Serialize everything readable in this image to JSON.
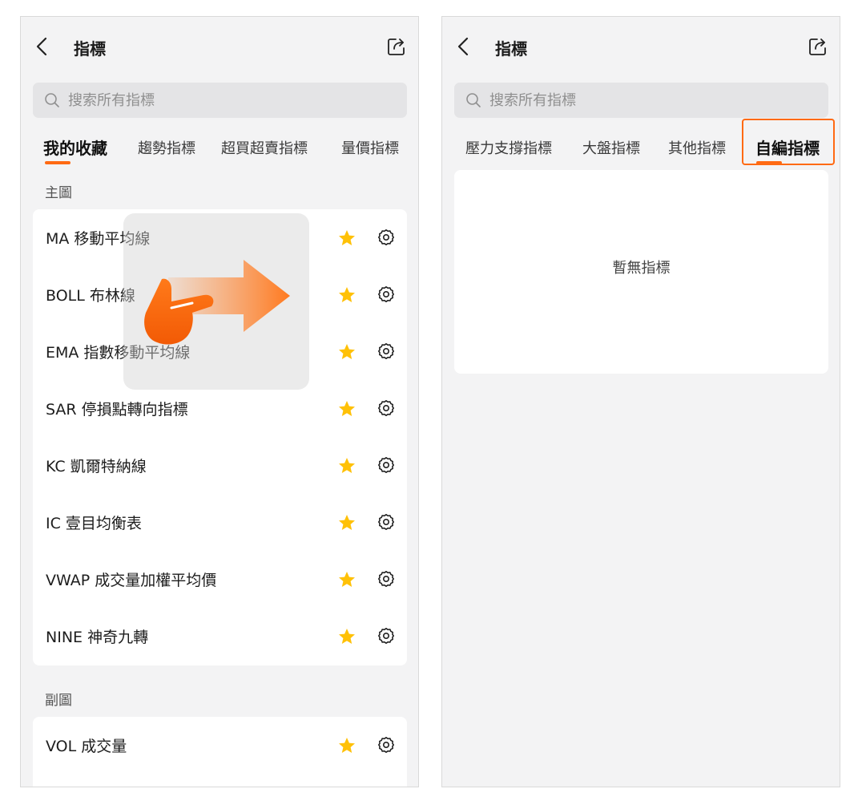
{
  "left_screen": {
    "title": "指標",
    "search_placeholder": "搜索所有指標",
    "tabs": [
      {
        "label": "我的收藏",
        "active": true
      },
      {
        "label": "趨勢指標",
        "active": false
      },
      {
        "label": "超買超賣指標",
        "active": false
      },
      {
        "label": "量價指標",
        "active": false
      }
    ],
    "sections": [
      {
        "label": "主圖",
        "items": [
          {
            "name": "MA 移動平均線",
            "favorite": true
          },
          {
            "name": "BOLL 布林線",
            "favorite": true
          },
          {
            "name": "EMA 指數移動平均線",
            "favorite": true
          },
          {
            "name": "SAR 停損點轉向指標",
            "favorite": true
          },
          {
            "name": "KC 凱爾特納線",
            "favorite": true
          },
          {
            "name": "IC 壹目均衡表",
            "favorite": true
          },
          {
            "name": "VWAP 成交量加權平均價",
            "favorite": true
          },
          {
            "name": "NINE 神奇九轉",
            "favorite": true
          }
        ]
      },
      {
        "label": "副圖",
        "items": [
          {
            "name": "VOL 成交量",
            "favorite": true
          }
        ]
      }
    ],
    "gesture": "swipe-right-hint"
  },
  "right_screen": {
    "title": "指標",
    "search_placeholder": "搜索所有指標",
    "tabs": [
      {
        "label": "壓力支撐指標",
        "active": false
      },
      {
        "label": "大盤指標",
        "active": false
      },
      {
        "label": "其他指標",
        "active": false
      },
      {
        "label": "自編指標",
        "active": true
      }
    ],
    "empty_message": "暫無指標"
  },
  "colors": {
    "accent": "#ff6a13",
    "star": "#ffc107",
    "background": "#f3f3f4",
    "card": "#ffffff"
  },
  "icons": [
    "back-arrow-icon",
    "share-icon",
    "search-icon",
    "star-icon",
    "gear-icon",
    "hand-pointer-icon",
    "arrow-right-icon"
  ]
}
